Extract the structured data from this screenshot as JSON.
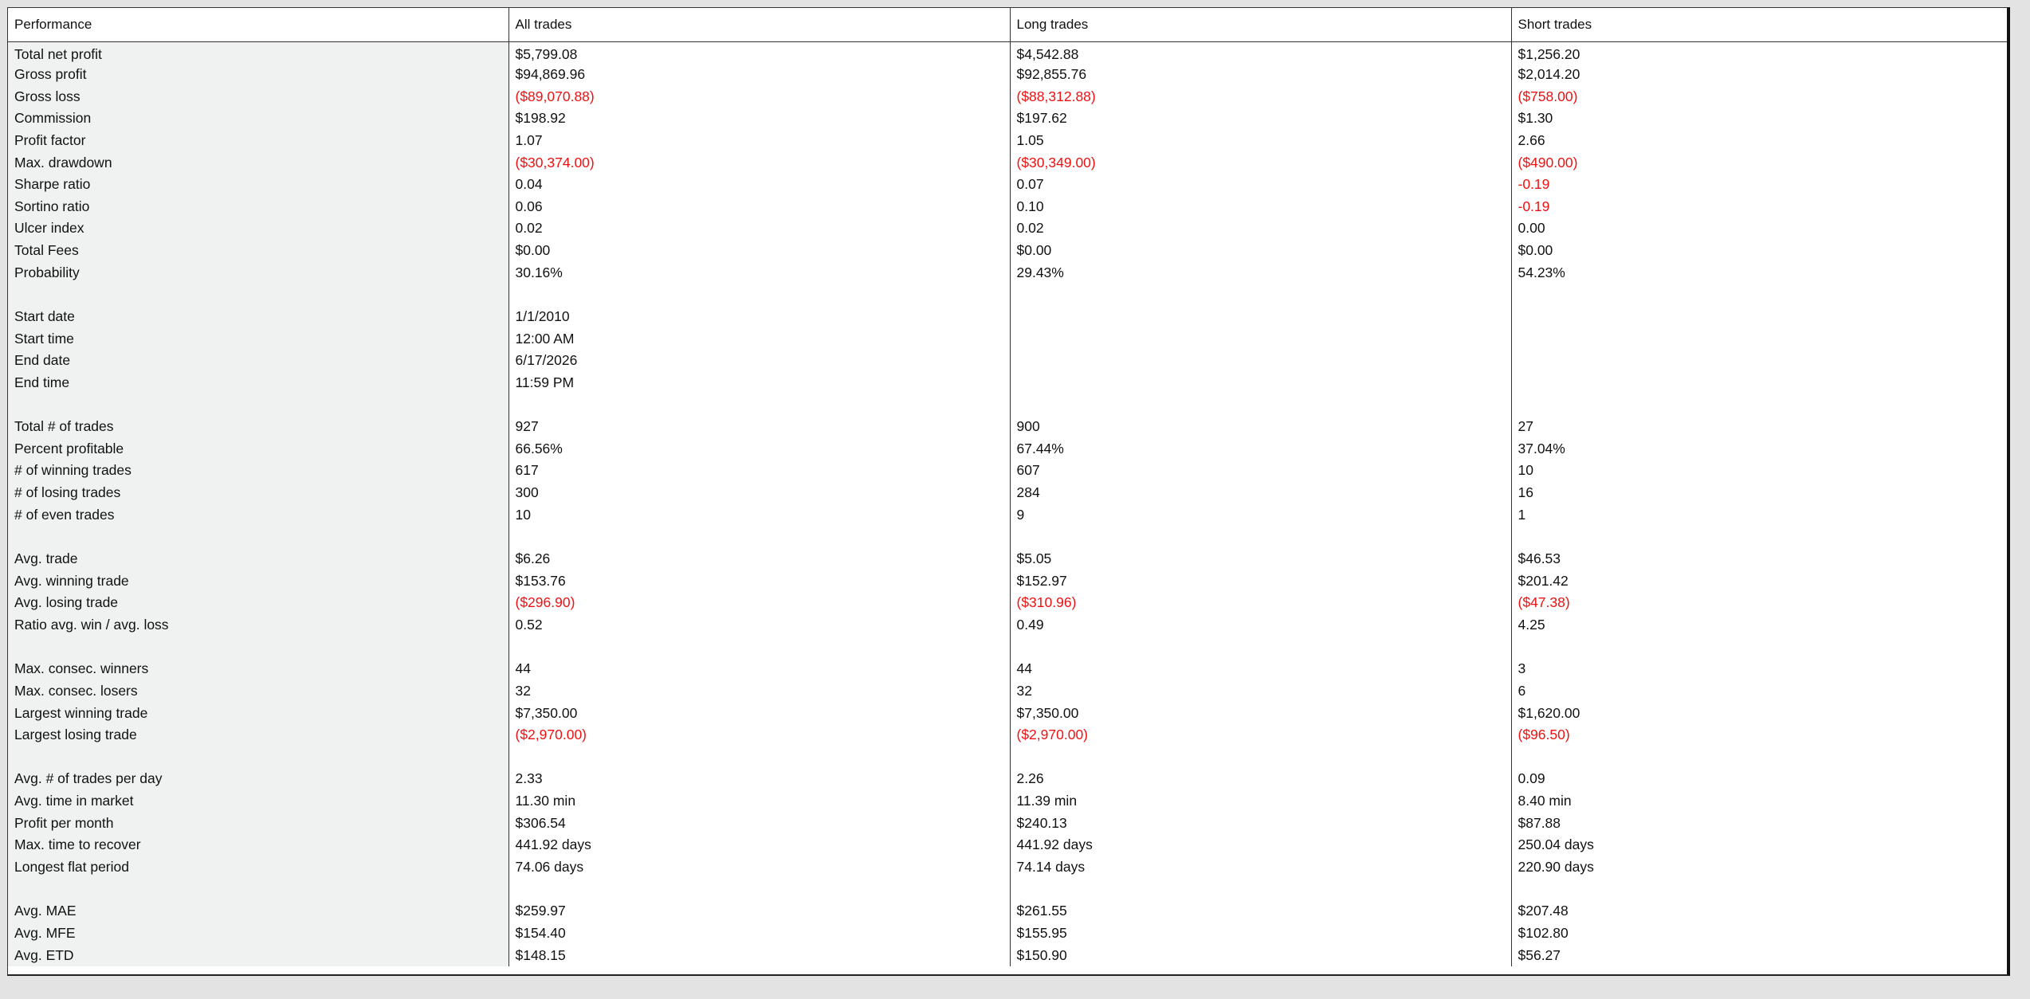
{
  "table": {
    "headers": [
      "Performance",
      "All trades",
      "Long trades",
      "Short trades"
    ],
    "rows": [
      {
        "label": "Total net profit",
        "values": [
          "$5,799.08",
          "$4,542.88",
          "$1,256.20"
        ],
        "neg": [
          false,
          false,
          false
        ]
      },
      {
        "label": "Gross profit",
        "values": [
          "$94,869.96",
          "$92,855.76",
          "$2,014.20"
        ],
        "neg": [
          false,
          false,
          false
        ]
      },
      {
        "label": "Gross loss",
        "values": [
          "($89,070.88)",
          "($88,312.88)",
          "($758.00)"
        ],
        "neg": [
          true,
          true,
          true
        ]
      },
      {
        "label": "Commission",
        "values": [
          "$198.92",
          "$197.62",
          "$1.30"
        ],
        "neg": [
          false,
          false,
          false
        ]
      },
      {
        "label": "Profit factor",
        "values": [
          "1.07",
          "1.05",
          "2.66"
        ],
        "neg": [
          false,
          false,
          false
        ]
      },
      {
        "label": "Max. drawdown",
        "values": [
          "($30,374.00)",
          "($30,349.00)",
          "($490.00)"
        ],
        "neg": [
          true,
          true,
          true
        ]
      },
      {
        "label": "Sharpe ratio",
        "values": [
          "0.04",
          "0.07",
          "-0.19"
        ],
        "neg": [
          false,
          false,
          true
        ]
      },
      {
        "label": "Sortino ratio",
        "values": [
          "0.06",
          "0.10",
          "-0.19"
        ],
        "neg": [
          false,
          false,
          true
        ]
      },
      {
        "label": "Ulcer index",
        "values": [
          "0.02",
          "0.02",
          "0.00"
        ],
        "neg": [
          false,
          false,
          false
        ]
      },
      {
        "label": "Total Fees",
        "values": [
          "$0.00",
          "$0.00",
          "$0.00"
        ],
        "neg": [
          false,
          false,
          false
        ]
      },
      {
        "label": "Probability",
        "values": [
          "30.16%",
          "29.43%",
          "54.23%"
        ],
        "neg": [
          false,
          false,
          false
        ]
      },
      {
        "label": "",
        "values": [
          "",
          "",
          ""
        ],
        "neg": [
          false,
          false,
          false
        ]
      },
      {
        "label": "Start date",
        "values": [
          "1/1/2010",
          "",
          ""
        ],
        "neg": [
          false,
          false,
          false
        ]
      },
      {
        "label": "Start time",
        "values": [
          "12:00 AM",
          "",
          ""
        ],
        "neg": [
          false,
          false,
          false
        ]
      },
      {
        "label": "End date",
        "values": [
          "6/17/2026",
          "",
          ""
        ],
        "neg": [
          false,
          false,
          false
        ]
      },
      {
        "label": "End time",
        "values": [
          "11:59 PM",
          "",
          ""
        ],
        "neg": [
          false,
          false,
          false
        ]
      },
      {
        "label": "",
        "values": [
          "",
          "",
          ""
        ],
        "neg": [
          false,
          false,
          false
        ]
      },
      {
        "label": "Total # of trades",
        "values": [
          "927",
          "900",
          "27"
        ],
        "neg": [
          false,
          false,
          false
        ]
      },
      {
        "label": "Percent profitable",
        "values": [
          "66.56%",
          "67.44%",
          "37.04%"
        ],
        "neg": [
          false,
          false,
          false
        ]
      },
      {
        "label": "# of winning trades",
        "values": [
          "617",
          "607",
          "10"
        ],
        "neg": [
          false,
          false,
          false
        ]
      },
      {
        "label": "# of losing trades",
        "values": [
          "300",
          "284",
          "16"
        ],
        "neg": [
          false,
          false,
          false
        ]
      },
      {
        "label": "# of even trades",
        "values": [
          "10",
          "9",
          "1"
        ],
        "neg": [
          false,
          false,
          false
        ]
      },
      {
        "label": "",
        "values": [
          "",
          "",
          ""
        ],
        "neg": [
          false,
          false,
          false
        ]
      },
      {
        "label": "Avg. trade",
        "values": [
          "$6.26",
          "$5.05",
          "$46.53"
        ],
        "neg": [
          false,
          false,
          false
        ]
      },
      {
        "label": "Avg. winning trade",
        "values": [
          "$153.76",
          "$152.97",
          "$201.42"
        ],
        "neg": [
          false,
          false,
          false
        ]
      },
      {
        "label": "Avg. losing trade",
        "values": [
          "($296.90)",
          "($310.96)",
          "($47.38)"
        ],
        "neg": [
          true,
          true,
          true
        ]
      },
      {
        "label": "Ratio avg. win / avg. loss",
        "values": [
          "0.52",
          "0.49",
          "4.25"
        ],
        "neg": [
          false,
          false,
          false
        ]
      },
      {
        "label": "",
        "values": [
          "",
          "",
          ""
        ],
        "neg": [
          false,
          false,
          false
        ]
      },
      {
        "label": "Max. consec. winners",
        "values": [
          "44",
          "44",
          "3"
        ],
        "neg": [
          false,
          false,
          false
        ]
      },
      {
        "label": "Max. consec. losers",
        "values": [
          "32",
          "32",
          "6"
        ],
        "neg": [
          false,
          false,
          false
        ]
      },
      {
        "label": "Largest winning trade",
        "values": [
          "$7,350.00",
          "$7,350.00",
          "$1,620.00"
        ],
        "neg": [
          false,
          false,
          false
        ]
      },
      {
        "label": "Largest losing trade",
        "values": [
          "($2,970.00)",
          "($2,970.00)",
          "($96.50)"
        ],
        "neg": [
          true,
          true,
          true
        ]
      },
      {
        "label": "",
        "values": [
          "",
          "",
          ""
        ],
        "neg": [
          false,
          false,
          false
        ]
      },
      {
        "label": "Avg. # of trades per day",
        "values": [
          "2.33",
          "2.26",
          "0.09"
        ],
        "neg": [
          false,
          false,
          false
        ]
      },
      {
        "label": "Avg. time in market",
        "values": [
          "11.30 min",
          "11.39 min",
          "8.40 min"
        ],
        "neg": [
          false,
          false,
          false
        ]
      },
      {
        "label": "Profit per month",
        "values": [
          "$306.54",
          "$240.13",
          "$87.88"
        ],
        "neg": [
          false,
          false,
          false
        ]
      },
      {
        "label": "Max. time to recover",
        "values": [
          "441.92 days",
          "441.92 days",
          "250.04 days"
        ],
        "neg": [
          false,
          false,
          false
        ]
      },
      {
        "label": "Longest flat period",
        "values": [
          "74.06 days",
          "74.14 days",
          "220.90 days"
        ],
        "neg": [
          false,
          false,
          false
        ]
      },
      {
        "label": "",
        "values": [
          "",
          "",
          ""
        ],
        "neg": [
          false,
          false,
          false
        ]
      },
      {
        "label": "Avg. MAE",
        "values": [
          "$259.97",
          "$261.55",
          "$207.48"
        ],
        "neg": [
          false,
          false,
          false
        ]
      },
      {
        "label": "Avg. MFE",
        "values": [
          "$154.40",
          "$155.95",
          "$102.80"
        ],
        "neg": [
          false,
          false,
          false
        ]
      },
      {
        "label": "Avg. ETD",
        "values": [
          "$148.15",
          "$150.90",
          "$56.27"
        ],
        "neg": [
          false,
          false,
          false
        ]
      }
    ]
  },
  "colors": {
    "negative": "#ee1111",
    "label_background": "#f0f2f2",
    "text": "#111111"
  }
}
